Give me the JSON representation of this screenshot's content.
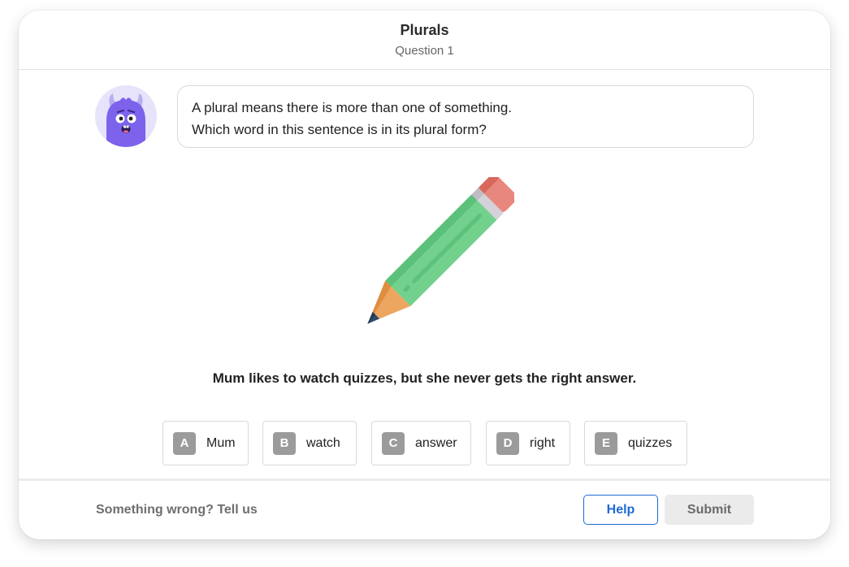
{
  "header": {
    "title": "Plurals",
    "subtitle": "Question 1"
  },
  "avatar": {
    "icon": "purple-monster-icon"
  },
  "prompt": {
    "line1": "A plural means there is more than one of something.",
    "line2": "Which word in this sentence is in its plural form?"
  },
  "illustration": {
    "icon": "pencil-icon"
  },
  "sentence": "Mum likes to watch quizzes, but she never gets the right answer.",
  "options": [
    {
      "letter": "A",
      "label": "Mum"
    },
    {
      "letter": "B",
      "label": "watch"
    },
    {
      "letter": "C",
      "label": "answer"
    },
    {
      "letter": "D",
      "label": "right"
    },
    {
      "letter": "E",
      "label": "quizzes"
    }
  ],
  "footer": {
    "report_label": "Something wrong? Tell us",
    "help_label": "Help",
    "submit_label": "Submit"
  },
  "colors": {
    "accent": "#1d6ad6",
    "letter_badge": "#9b9b9b",
    "submit_disabled": "#ebebeb"
  }
}
